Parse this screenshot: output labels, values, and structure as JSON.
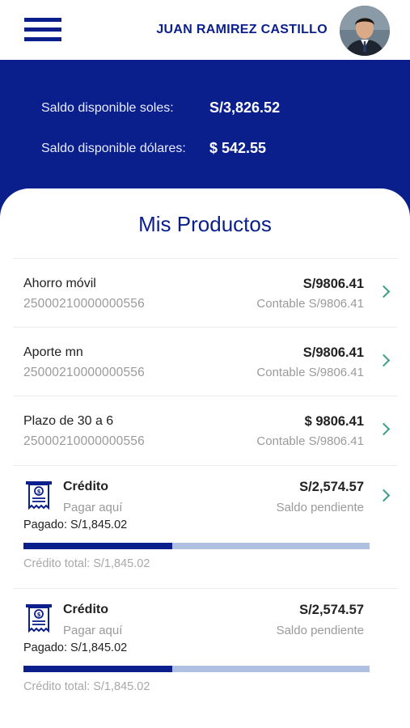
{
  "header": {
    "user_name": "JUAN RAMIREZ CASTILLO"
  },
  "balances": {
    "soles_label": "Saldo disponible soles:",
    "soles_value": "S/3,826.52",
    "dolares_label": "Saldo disponible dólares:",
    "dolares_value": "$ 542.55"
  },
  "products_title": "Mis Productos",
  "products": [
    {
      "name": "Ahorro móvil",
      "number": "25000210000000556",
      "amount": "S/9806.41",
      "accounting": "Contable S/9806.41"
    },
    {
      "name": "Aporte mn",
      "number": "25000210000000556",
      "amount": "S/9806.41",
      "accounting": "Contable S/9806.41"
    },
    {
      "name": "Plazo de 30 a 6",
      "number": "25000210000000556",
      "amount": "$ 9806.41",
      "accounting": "Contable S/9806.41"
    }
  ],
  "credits": [
    {
      "name": "Crédito",
      "pay_link": "Pagar aquí",
      "paid": "Pagado: S/1,845.02",
      "amount": "S/2,574.57",
      "status": "Saldo pendiente",
      "total": "Crédito total: S/1,845.02",
      "progress": 0.43
    },
    {
      "name": "Crédito",
      "pay_link": "Pagar aquí",
      "paid": "Pagado: S/1,845.02",
      "amount": "S/2,574.57",
      "status": "Saldo pendiente",
      "total": "Crédito total: S/1,845.02",
      "progress": 0.43
    }
  ],
  "colors": {
    "primary": "#0a1e8c",
    "progress_track": "#aebfe0",
    "chevron": "#3a9d8a"
  },
  "icons": {
    "menu": "hamburger-menu-icon",
    "chevron": "chevron-right-icon",
    "credit": "receipt-dollar-icon"
  }
}
